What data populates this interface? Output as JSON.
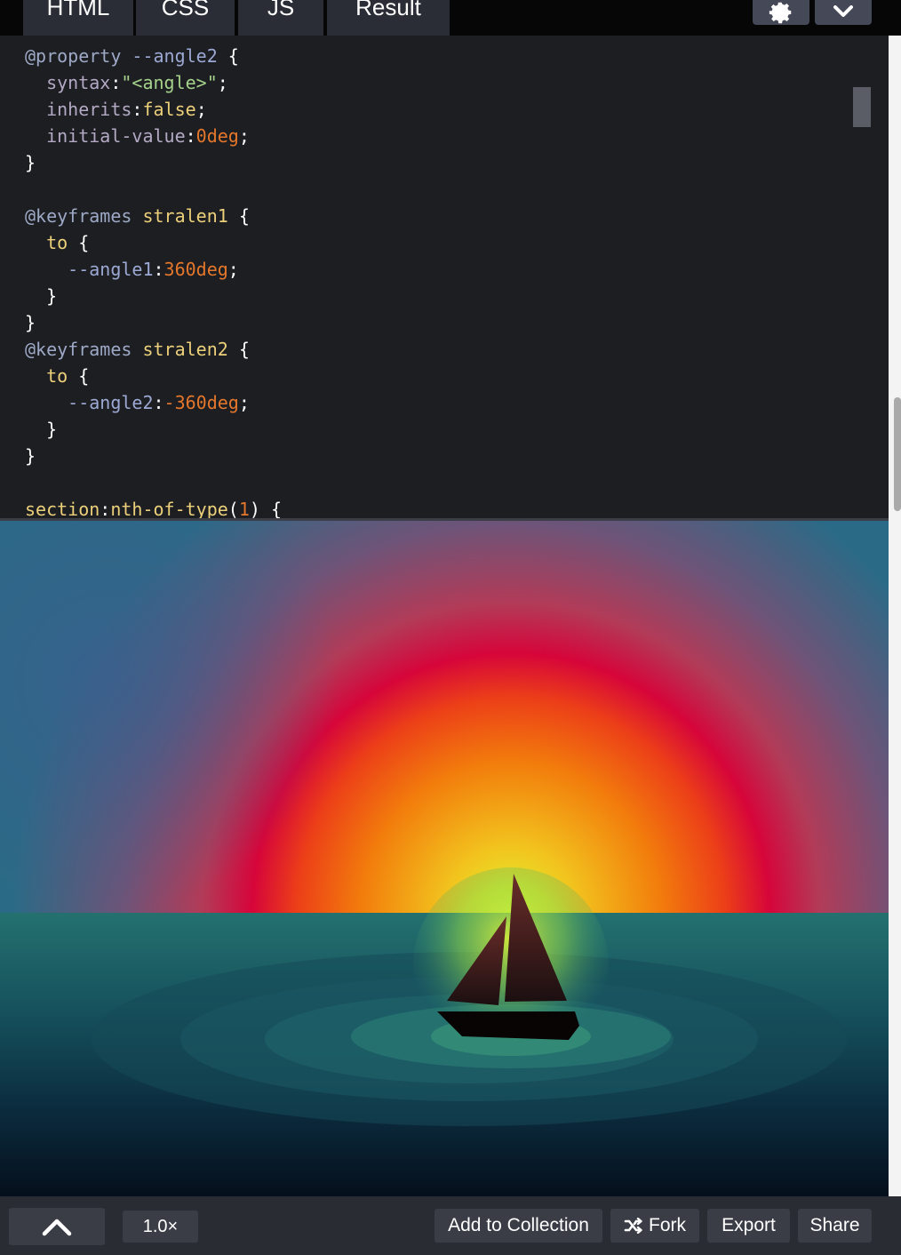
{
  "tabs": [
    {
      "label": "HTML"
    },
    {
      "label": "CSS"
    },
    {
      "label": "JS"
    },
    {
      "label": "Result"
    }
  ],
  "toolbar_icons": [
    "gear-icon",
    "chevron-down-icon"
  ],
  "code_lines": [
    "@property --angle2 {",
    "  syntax:\"<angle>\";",
    "  inherits:false;",
    "  initial-value:0deg;",
    "}",
    "",
    "@keyframes stralen1 {",
    "  to {",
    "    --angle1:360deg;",
    "  }",
    "}",
    "@keyframes stralen2 {",
    "  to {",
    "    --angle2:-360deg;",
    "  }",
    "}",
    "",
    "section:nth-of-type(1) {"
  ],
  "bottom_bar": {
    "collapse_icon": "chevron-up-icon",
    "zoom_label": "1.0×",
    "add_to_collection_label": "Add to Collection",
    "fork_label": "Fork",
    "export_label": "Export",
    "share_label": "Share"
  },
  "colors": {
    "editor_bg": "#1d1e22",
    "tab_bg": "#2a2d36",
    "button_bg": "#3a3d46"
  }
}
